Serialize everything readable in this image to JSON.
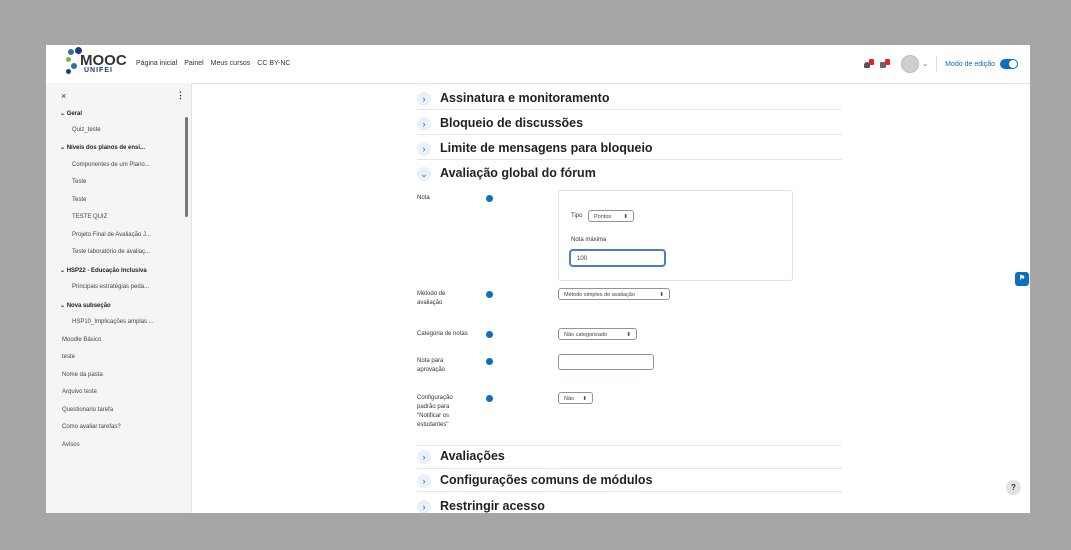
{
  "navbar": {
    "logo_text": "MOOC",
    "logo_sub": "UNIFEI",
    "links": [
      "Página inicial",
      "Painel",
      "Meus cursos",
      "CC BY-NC"
    ],
    "edit_mode_label": "Modo de edição",
    "caret": "⌄"
  },
  "sidebar": {
    "close": "×",
    "menu": "⋮",
    "items": [
      {
        "label": "⌄ Geral",
        "bold": true
      },
      {
        "label": "Quiz_teste",
        "bold": false
      },
      {
        "label": "⌄ Níveis dos planos de ensi...",
        "bold": true
      },
      {
        "label": "Componentes de um Plano...",
        "bold": false
      },
      {
        "label": "Teste",
        "bold": false
      },
      {
        "label": "Teste",
        "bold": false
      },
      {
        "label": "TESTE QUIZ",
        "bold": false
      },
      {
        "label": "Projeto Final de Avaliação J...",
        "bold": false
      },
      {
        "label": "Teste laboratório de avaliaç...",
        "bold": false
      },
      {
        "label": "⌄ HSP22 - Educação Inclusiva",
        "bold": true
      },
      {
        "label": "Principais estratégias peda...",
        "bold": false
      },
      {
        "label": "⌄ Nova subseção",
        "bold": true
      },
      {
        "label": "HSP10_Implicações amplas ...",
        "bold": false
      },
      {
        "label": "Moodle Básico",
        "bold": false
      },
      {
        "label": "teste",
        "bold": false
      },
      {
        "label": "Nome da pasta",
        "bold": false
      },
      {
        "label": "Arquivo teste",
        "bold": false
      },
      {
        "label": "Questionario tarefa",
        "bold": false
      },
      {
        "label": "Como avaliar tarefas?",
        "bold": false
      },
      {
        "label": "Avisos",
        "bold": false
      }
    ]
  },
  "sections": {
    "assinatura": "Assinatura e monitoramento",
    "bloqueio": "Bloqueio de discussões",
    "limite": "Limite de mensagens para bloqueio",
    "avaliacao_global": "Avaliação global do fórum",
    "avaliacoes": "Avaliações",
    "config_comuns": "Configurações comuns de módulos",
    "restringir": "Restringir acesso"
  },
  "chevrons": {
    "collapsed": "›",
    "expanded": "⌄"
  },
  "form": {
    "nota_label": "Nota",
    "tipo_label": "Tipo",
    "tipo_value": "Pontos",
    "nota_maxima_label": "Nota máxima",
    "nota_maxima_value": "100",
    "metodo_label_1": "Método de",
    "metodo_label_2": "avaliação",
    "metodo_value": "Método simples de avaliação",
    "categoria_label": "Categoria de notas",
    "categoria_value": "Não categorizado",
    "aprovacao_label_1": "Nota para",
    "aprovacao_label_2": "aprovação",
    "aprovacao_value": "",
    "notificar_label_1": "Configuração",
    "notificar_label_2": "padrão para",
    "notificar_label_3": "\"Notificar os",
    "notificar_label_4": "estudantes\"",
    "notificar_value": "Não",
    "select_arrow": "⬍"
  },
  "help_button": "?",
  "colors": {
    "accent": "#0f6cbf",
    "frame": "#a6a6a6"
  }
}
